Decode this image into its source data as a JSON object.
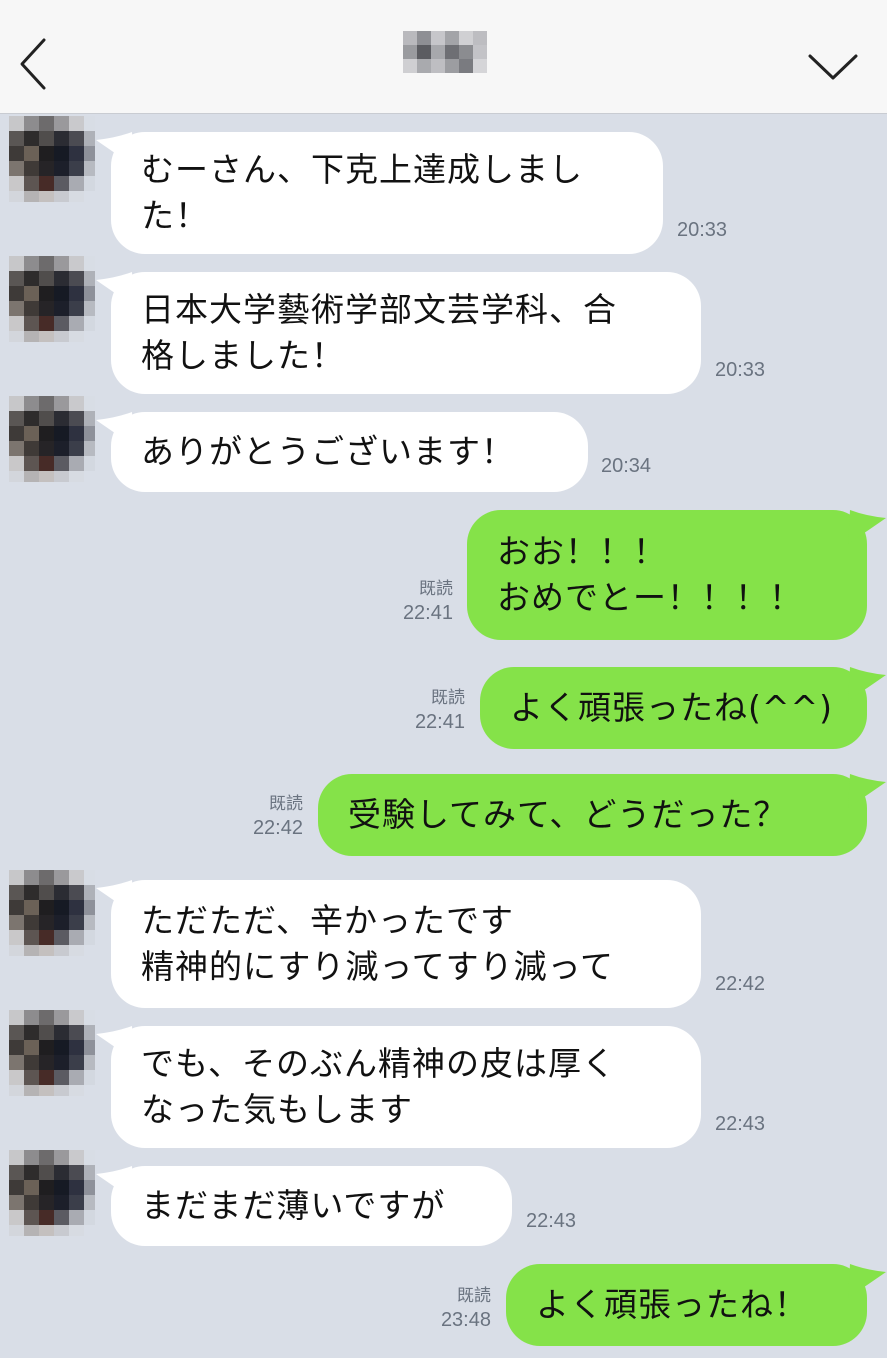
{
  "header": {
    "back_icon": "chevron-left-icon",
    "menu_icon": "chevron-down-icon",
    "title_obscured": true
  },
  "colors": {
    "background": "#d9dee7",
    "incoming_bubble": "#ffffff",
    "outgoing_bubble": "#85e249",
    "header": "#f7f7f7",
    "meta_text": "#6a7380"
  },
  "messages": [
    {
      "direction": "in",
      "text": "むーさん、下克上達成しまし\nた！",
      "time": "20:33"
    },
    {
      "direction": "in",
      "text": "日本大学藝術学部文芸学科、合\n格しました！",
      "time": "20:33"
    },
    {
      "direction": "in",
      "text": "ありがとうございます！",
      "time": "20:34"
    },
    {
      "direction": "out",
      "text": "おお！！！\nおめでとー！！！！",
      "read": "既読",
      "time": "22:41"
    },
    {
      "direction": "out",
      "text": "よく頑張ったね(^^)",
      "read": "既読",
      "time": "22:41"
    },
    {
      "direction": "out",
      "text": "受験してみて、どうだった？",
      "read": "既読",
      "time": "22:42"
    },
    {
      "direction": "in",
      "text": "ただただ、辛かったです\n精神的にすり減ってすり減って",
      "time": "22:42"
    },
    {
      "direction": "in",
      "text": "でも、そのぶん精神の皮は厚く\nなった気もします",
      "time": "22:43"
    },
    {
      "direction": "in",
      "text": "まだまだ薄いですが",
      "time": "22:43"
    },
    {
      "direction": "out",
      "text": "よく頑張ったね！",
      "read": "既読",
      "time": "23:48"
    }
  ]
}
